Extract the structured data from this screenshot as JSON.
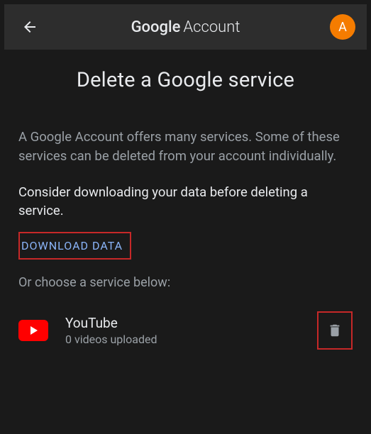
{
  "header": {
    "title_bold": "Google",
    "title_light": "Account",
    "avatar_initial": "A"
  },
  "page": {
    "title": "Delete a Google service",
    "description": "A Google Account offers many services. Some of these services can be deleted from your account individually.",
    "instruction": "Consider downloading your data before deleting a service.",
    "download_label": "DOWNLOAD DATA",
    "sub_instruction": "Or choose a service below:"
  },
  "services": [
    {
      "name": "YouTube",
      "detail": "0 videos uploaded",
      "icon": "youtube"
    }
  ],
  "colors": {
    "accent": "#f57c00",
    "link": "#8ab4f8",
    "highlight_border": "#c62828",
    "youtube_red": "#ff0000"
  }
}
